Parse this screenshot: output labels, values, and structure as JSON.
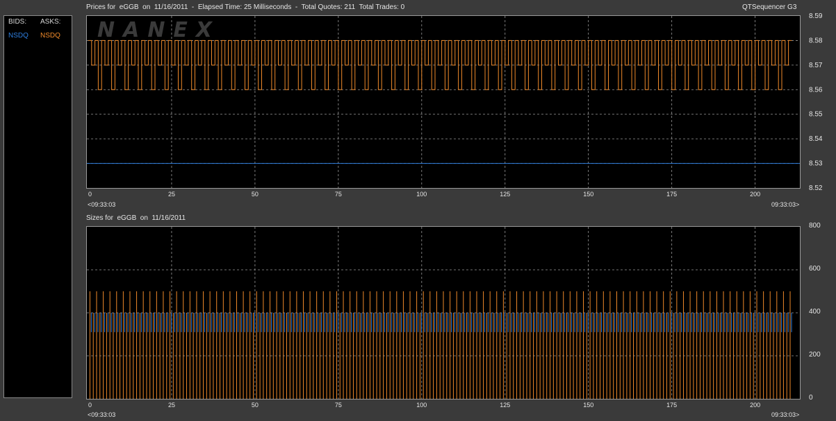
{
  "legend": {
    "bids_label": "BIDS:",
    "asks_label": "ASKS:",
    "bid_exchange": "NSDQ",
    "ask_exchange": "NSDQ"
  },
  "header": {
    "prices_title": "Prices for  eGGB  on  11/16/2011  -  Elapsed Time: 25 Milliseconds  -  Total Quotes: 211  Total Trades: 0",
    "app_name": "QTSequencer G3",
    "sizes_title": "Sizes for  eGGB  on  11/16/2011"
  },
  "watermark": "NANEX",
  "time_start": "<09:33:03",
  "time_end": "09:33:03>",
  "colors": {
    "bid": "#2f7fe0",
    "ask": "#f08a2a",
    "grid": "#9a9a9a"
  },
  "chart_data": [
    {
      "type": "line",
      "title": "Prices for  eGGB  on  11/16/2011",
      "x_ticks": [
        0,
        25,
        50,
        75,
        100,
        125,
        150,
        175,
        200
      ],
      "y_ticks": [
        "8.52",
        "8.53",
        "8.54",
        "8.55",
        "8.56",
        "8.57",
        "8.58",
        "8.59"
      ],
      "xlim": [
        0,
        213
      ],
      "ylim": [
        8.52,
        8.59
      ],
      "grid": true,
      "series": [
        {
          "name": "BIDS: NSDQ",
          "color": "#2f7fe0",
          "constant": 8.53
        },
        {
          "name": "ASKS: NSDQ",
          "color": "#f08a2a",
          "pattern": [
            8.58,
            8.57,
            8.58,
            8.56
          ],
          "count": 211
        }
      ]
    },
    {
      "type": "bar",
      "title": "Sizes for  eGGB  on  11/16/2011",
      "x_ticks": [
        0,
        25,
        50,
        75,
        100,
        125,
        150,
        175,
        200
      ],
      "y_ticks": [
        "0",
        "200",
        "400",
        "600",
        "800"
      ],
      "xlim": [
        0,
        213
      ],
      "ylim": [
        0,
        800
      ],
      "grid": true,
      "series": [
        {
          "name": "BIDS: NSDQ",
          "color": "#2f7fe0",
          "constant": 400
        },
        {
          "name": "ASKS: NSDQ",
          "color": "#f08a2a",
          "values_range": [
            400,
            500
          ],
          "count": 211
        }
      ]
    }
  ]
}
